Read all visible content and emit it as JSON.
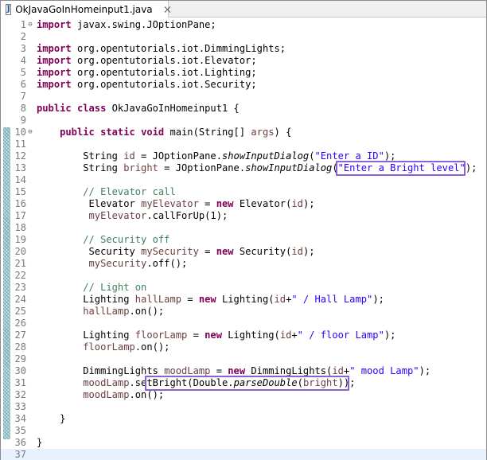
{
  "tab": {
    "icon_letter": "J",
    "title": "OkJavaGoInHomeinput1.java"
  },
  "lines": [
    {
      "n": "1",
      "fold": "⊖",
      "tokens": [
        {
          "t": "import",
          "c": "kw"
        },
        {
          "t": " javax.swing.JOptionPane;"
        }
      ]
    },
    {
      "n": "2",
      "tokens": []
    },
    {
      "n": "3",
      "tokens": [
        {
          "t": "import",
          "c": "kw"
        },
        {
          "t": " org.opentutorials.iot.DimmingLights;"
        }
      ]
    },
    {
      "n": "4",
      "tokens": [
        {
          "t": "import",
          "c": "kw"
        },
        {
          "t": " org.opentutorials.iot.Elevator;"
        }
      ]
    },
    {
      "n": "5",
      "tokens": [
        {
          "t": "import",
          "c": "kw"
        },
        {
          "t": " org.opentutorials.iot.Lighting;"
        }
      ]
    },
    {
      "n": "6",
      "tokens": [
        {
          "t": "import",
          "c": "kw"
        },
        {
          "t": " org.opentutorials.iot.Security;"
        }
      ]
    },
    {
      "n": "7",
      "tokens": []
    },
    {
      "n": "8",
      "tokens": [
        {
          "t": "public",
          "c": "kw"
        },
        {
          "t": " "
        },
        {
          "t": "class",
          "c": "kw"
        },
        {
          "t": " OkJavaGoInHomeinput1 {"
        }
      ]
    },
    {
      "n": "9",
      "tokens": []
    },
    {
      "n": "10",
      "fold": "⊖",
      "tokens": [
        {
          "t": "    "
        },
        {
          "t": "public",
          "c": "kw"
        },
        {
          "t": " "
        },
        {
          "t": "static",
          "c": "kw"
        },
        {
          "t": " "
        },
        {
          "t": "void",
          "c": "kw"
        },
        {
          "t": " main(String[] "
        },
        {
          "t": "args",
          "c": "fld"
        },
        {
          "t": ") {"
        }
      ]
    },
    {
      "n": "11",
      "tokens": []
    },
    {
      "n": "12",
      "tokens": [
        {
          "t": "        String "
        },
        {
          "t": "id",
          "c": "fld"
        },
        {
          "t": " = JOptionPane."
        },
        {
          "t": "showInputDialog",
          "c": "it"
        },
        {
          "t": "("
        },
        {
          "t": "\"Enter a ID\"",
          "c": "str"
        },
        {
          "t": ");"
        }
      ]
    },
    {
      "n": "13",
      "tokens": [
        {
          "t": "        String "
        },
        {
          "t": "bright",
          "c": "fld"
        },
        {
          "t": " = JOptionPane."
        },
        {
          "t": "showInputDialog",
          "c": "it"
        },
        {
          "t": "("
        },
        {
          "t": "\"Enter a Bright level\"",
          "c": "str"
        },
        {
          "t": ");"
        }
      ]
    },
    {
      "n": "14",
      "tokens": []
    },
    {
      "n": "15",
      "tokens": [
        {
          "t": "        "
        },
        {
          "t": "// Elevator call",
          "c": "cm"
        }
      ]
    },
    {
      "n": "16",
      "tokens": [
        {
          "t": "         Elevator "
        },
        {
          "t": "myElevator",
          "c": "fld"
        },
        {
          "t": " = "
        },
        {
          "t": "new",
          "c": "kw"
        },
        {
          "t": " Elevator("
        },
        {
          "t": "id",
          "c": "fld"
        },
        {
          "t": ");"
        }
      ]
    },
    {
      "n": "17",
      "tokens": [
        {
          "t": "         "
        },
        {
          "t": "myElevator",
          "c": "fld"
        },
        {
          "t": ".callForUp(1);"
        }
      ]
    },
    {
      "n": "18",
      "tokens": []
    },
    {
      "n": "19",
      "tokens": [
        {
          "t": "        "
        },
        {
          "t": "// Security off",
          "c": "cm"
        }
      ]
    },
    {
      "n": "20",
      "tokens": [
        {
          "t": "         Security "
        },
        {
          "t": "mySecurity",
          "c": "fld"
        },
        {
          "t": " = "
        },
        {
          "t": "new",
          "c": "kw"
        },
        {
          "t": " Security("
        },
        {
          "t": "id",
          "c": "fld"
        },
        {
          "t": ");"
        }
      ]
    },
    {
      "n": "21",
      "tokens": [
        {
          "t": "         "
        },
        {
          "t": "mySecurity",
          "c": "fld"
        },
        {
          "t": ".off();"
        }
      ]
    },
    {
      "n": "22",
      "tokens": []
    },
    {
      "n": "23",
      "tokens": [
        {
          "t": "        "
        },
        {
          "t": "// Light on",
          "c": "cm"
        }
      ]
    },
    {
      "n": "24",
      "tokens": [
        {
          "t": "        Lighting "
        },
        {
          "t": "hallLamp",
          "c": "fld"
        },
        {
          "t": " = "
        },
        {
          "t": "new",
          "c": "kw"
        },
        {
          "t": " Lighting("
        },
        {
          "t": "id",
          "c": "fld"
        },
        {
          "t": "+"
        },
        {
          "t": "\" / Hall Lamp\"",
          "c": "str"
        },
        {
          "t": ");"
        }
      ]
    },
    {
      "n": "25",
      "tokens": [
        {
          "t": "        "
        },
        {
          "t": "hallLamp",
          "c": "fld"
        },
        {
          "t": ".on();"
        }
      ]
    },
    {
      "n": "26",
      "tokens": []
    },
    {
      "n": "27",
      "tokens": [
        {
          "t": "        Lighting "
        },
        {
          "t": "floorLamp",
          "c": "fld"
        },
        {
          "t": " = "
        },
        {
          "t": "new",
          "c": "kw"
        },
        {
          "t": " Lighting("
        },
        {
          "t": "id",
          "c": "fld"
        },
        {
          "t": "+"
        },
        {
          "t": "\" / floor Lamp\"",
          "c": "str"
        },
        {
          "t": ");"
        }
      ]
    },
    {
      "n": "28",
      "tokens": [
        {
          "t": "        "
        },
        {
          "t": "floorLamp",
          "c": "fld"
        },
        {
          "t": ".on();"
        }
      ]
    },
    {
      "n": "29",
      "tokens": []
    },
    {
      "n": "30",
      "tokens": [
        {
          "t": "        DimmingLights "
        },
        {
          "t": "moodLamp",
          "c": "fld"
        },
        {
          "t": " = "
        },
        {
          "t": "new",
          "c": "kw"
        },
        {
          "t": " DimmingLights("
        },
        {
          "t": "id",
          "c": "fld"
        },
        {
          "t": "+"
        },
        {
          "t": "\" mood Lamp\"",
          "c": "str"
        },
        {
          "t": ");"
        }
      ]
    },
    {
      "n": "31",
      "tokens": [
        {
          "t": "        "
        },
        {
          "t": "moodLamp",
          "c": "fld"
        },
        {
          "t": ".setBright(Double."
        },
        {
          "t": "parseDouble",
          "c": "it"
        },
        {
          "t": "("
        },
        {
          "t": "bright",
          "c": "fld"
        },
        {
          "t": "));"
        }
      ]
    },
    {
      "n": "32",
      "tokens": [
        {
          "t": "        "
        },
        {
          "t": "moodLamp",
          "c": "fld"
        },
        {
          "t": ".on();"
        }
      ]
    },
    {
      "n": "33",
      "tokens": []
    },
    {
      "n": "34",
      "tokens": [
        {
          "t": "    }"
        }
      ]
    },
    {
      "n": "35",
      "tokens": []
    },
    {
      "n": "36",
      "tokens": [
        {
          "t": "}"
        }
      ]
    },
    {
      "n": "37",
      "current": true,
      "tokens": []
    }
  ],
  "highlights": [
    {
      "name": "highlight-bright-prompt",
      "line": 13
    },
    {
      "name": "highlight-parse-double",
      "line": 31
    }
  ],
  "colors": {
    "keyword": "#7f0055",
    "string": "#2a00ff",
    "comment": "#3f7f5f",
    "field": "#6a3e3e",
    "highlight_box": "#8b5fd6",
    "current_line": "#e8f2fe"
  }
}
